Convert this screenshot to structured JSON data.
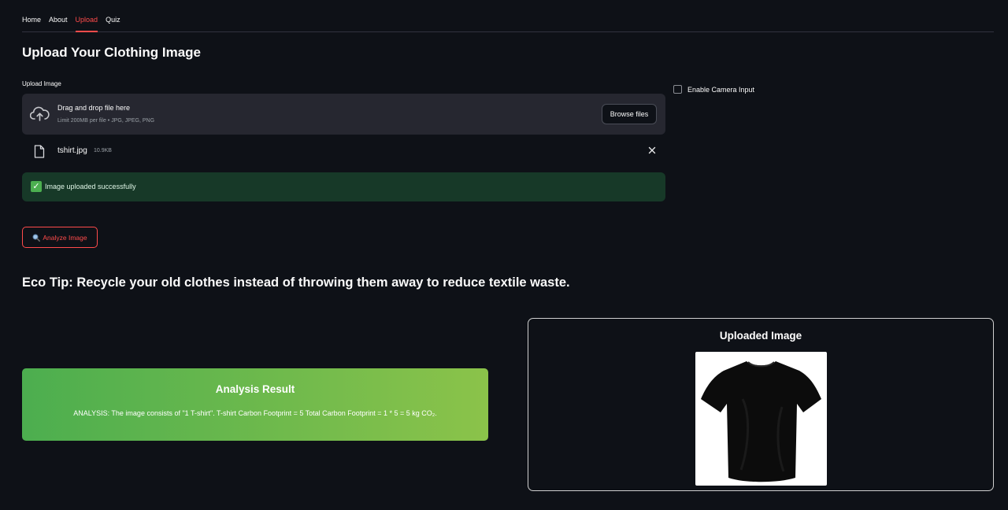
{
  "nav": {
    "tabs": [
      {
        "label": "Home"
      },
      {
        "label": "About"
      },
      {
        "label": "Upload",
        "active": true
      },
      {
        "label": "Quiz"
      }
    ]
  },
  "page": {
    "title": "Upload Your Clothing Image"
  },
  "uploader": {
    "label": "Upload Image",
    "drop_text": "Drag and drop file here",
    "limit_text": "Limit 200MB per file • JPG, JPEG, PNG",
    "browse_label": "Browse files",
    "file": {
      "name": "tshirt.jpg",
      "size": "10.9KB"
    }
  },
  "camera": {
    "label": "Enable Camera Input",
    "checked": false
  },
  "status": {
    "message": "Image uploaded successfully"
  },
  "actions": {
    "analyze_label": "Analyze Image"
  },
  "eco_tip": "Eco Tip: Recycle your old clothes instead of throwing them away to reduce textile waste.",
  "result": {
    "title": "Analysis Result",
    "text": "ANALYSIS: The image consists of \"1 T-shirt\". T-shirt Carbon Footprint = 5 Total Carbon Footprint = 1 * 5 = 5 kg CO₂."
  },
  "preview": {
    "title": "Uploaded Image"
  },
  "icons": {
    "upload": "cloud-upload-icon",
    "file": "file-icon",
    "remove": "close-icon",
    "success": "check-icon",
    "analyze": "magnifier-icon"
  },
  "colors": {
    "background": "#0e1117",
    "accent": "#ff4b4b",
    "success_bg": "#173928",
    "result_gradient_start": "#4cae4f",
    "result_gradient_end": "#8bc34a"
  }
}
